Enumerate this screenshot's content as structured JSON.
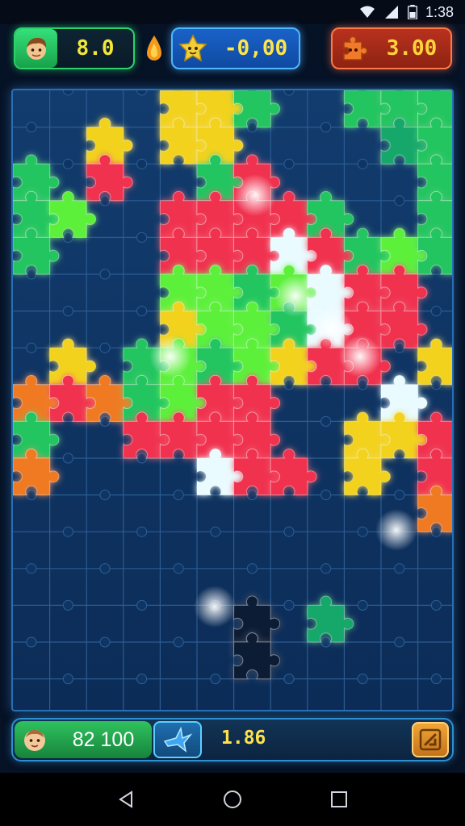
{
  "status_bar": {
    "time": "1:38",
    "icons": [
      "wifi-icon",
      "signal-icon",
      "battery-icon"
    ]
  },
  "hud_top": {
    "player_value": "8.0",
    "drop_icon": "flame-drop-icon",
    "blue_value": "-0,00",
    "red_value": "3.00"
  },
  "board": {
    "colors": {
      "green": "#22c55e",
      "lime": "#5cf03a",
      "yellow": "#f2d21c",
      "red": "#f0334f",
      "orange": "#ef7a22",
      "white": "#e9fbff",
      "dark": "#0b1e36",
      "teal": "#14a86a"
    }
  },
  "hud_bottom": {
    "score": "82 100",
    "multiplier": "1.86",
    "action_icon": "edit-icon"
  },
  "nav_bar": {
    "buttons": [
      "back-icon",
      "home-icon",
      "recents-icon"
    ]
  }
}
